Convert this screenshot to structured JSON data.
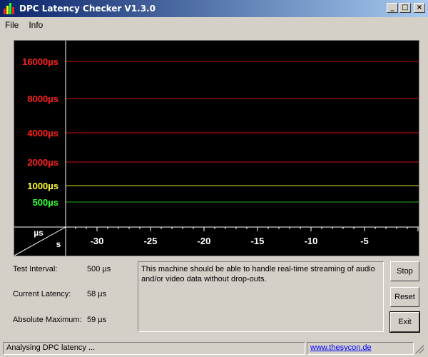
{
  "window": {
    "title": "DPC Latency Checker V1.3.0"
  },
  "menu": {
    "file": "File",
    "info": "Info"
  },
  "graph": {
    "y_labels": [
      {
        "text": "16000µs",
        "color": "#ff2020"
      },
      {
        "text": "8000µs",
        "color": "#ff2020"
      },
      {
        "text": "4000µs",
        "color": "#ff2020"
      },
      {
        "text": "2000µs",
        "color": "#ff2020"
      },
      {
        "text": "1000µs",
        "color": "#ffff33"
      },
      {
        "text": "500µs",
        "color": "#33ff33"
      }
    ],
    "line_colors": [
      "#cc1111",
      "#cc1111",
      "#cc1111",
      "#cc1111",
      "#d8d820",
      "#20b020"
    ],
    "corner_y_unit": "µs",
    "corner_x_unit": "s",
    "x_ticks": [
      "-30",
      "-25",
      "-20",
      "-15",
      "-10",
      "-5"
    ],
    "bar_color": "#22ff22",
    "bar_values_us": [
      56,
      58,
      57,
      56,
      56,
      57,
      57,
      56,
      58,
      57,
      56,
      57,
      58,
      57,
      56,
      57,
      56,
      58,
      57,
      56,
      57,
      56,
      57,
      57,
      58,
      57,
      56,
      57,
      56,
      57,
      58,
      57,
      56,
      57,
      58,
      57,
      56,
      57,
      58,
      57,
      56,
      57,
      58,
      57,
      57,
      56,
      57,
      58,
      56,
      57
    ]
  },
  "info": {
    "test_interval_label": "Test Interval:",
    "test_interval_value": "500 µs",
    "current_latency_label": "Current Latency:",
    "current_latency_value": "58 µs",
    "absolute_max_label": "Absolute Maximum:",
    "absolute_max_value": "59 µs"
  },
  "message": "This machine should be able to handle real-time streaming of audio and/or video data without drop-outs.",
  "buttons": {
    "stop": "Stop",
    "reset": "Reset",
    "exit": "Exit"
  },
  "status": {
    "text": "Analysing DPC latency ...",
    "link": "www.thesycon.de"
  }
}
